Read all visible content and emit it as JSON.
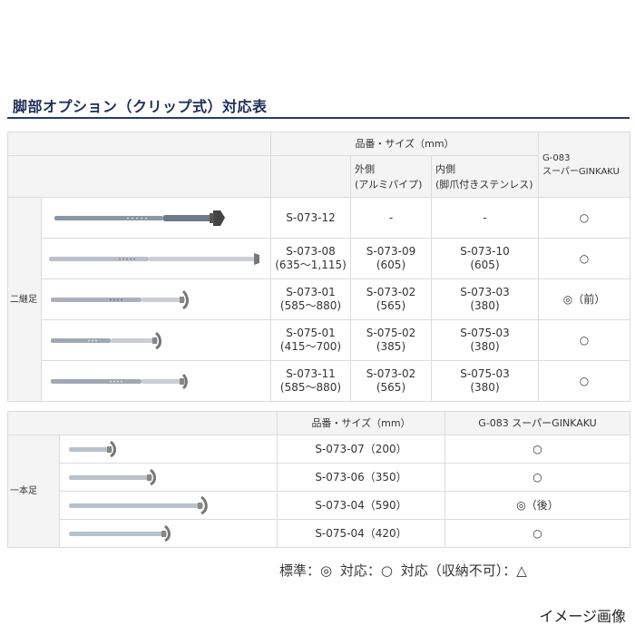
{
  "title": "脚部オプション（クリップ式）対応表",
  "table1": {
    "header_size": "品番・サイズ（mm）",
    "col_outer": "外側",
    "col_outer_sub": "(アルミパイプ)",
    "col_inner": "内側",
    "col_inner_sub": "(脚爪付きステンレス)",
    "col_model": "G-083\nスーパーGINKAKU",
    "group_label": "二継足",
    "rows": [
      {
        "size": "S-073-12",
        "outer": "-",
        "inner": "-",
        "compat": "○"
      },
      {
        "size": "S-073-08\n(635～1,115)",
        "outer": "S-073-09\n(605)",
        "inner": "S-073-10\n(605)",
        "compat": "○"
      },
      {
        "size": "S-073-01\n(585～880)",
        "outer": "S-073-02\n(565)",
        "inner": "S-073-03\n(380)",
        "compat": "◎（前）"
      },
      {
        "size": "S-075-01\n(415～700)",
        "outer": "S-075-02\n(385)",
        "inner": "S-075-03\n(380)",
        "compat": "○"
      },
      {
        "size": "S-073-11\n(585～880)",
        "outer": "S-073-02\n(565)",
        "inner": "S-075-03\n(380)",
        "compat": "○"
      }
    ]
  },
  "table2": {
    "header_size": "品番・サイズ（mm）",
    "col_model": "G-083 スーパーGINKAKU",
    "group_label": "一本足",
    "rows": [
      {
        "size": "S-073-07（200）",
        "compat": "○"
      },
      {
        "size": "S-073-06（350）",
        "compat": "○"
      },
      {
        "size": "S-073-04（590）",
        "compat": "◎（後）"
      },
      {
        "size": "S-075-04（420）",
        "compat": "○"
      }
    ]
  },
  "legend": {
    "standard": "標準：◎",
    "compatible": "対応：○",
    "compatible_no_storage": "対応（収納不可）：△"
  },
  "caption": "イメージ画像"
}
